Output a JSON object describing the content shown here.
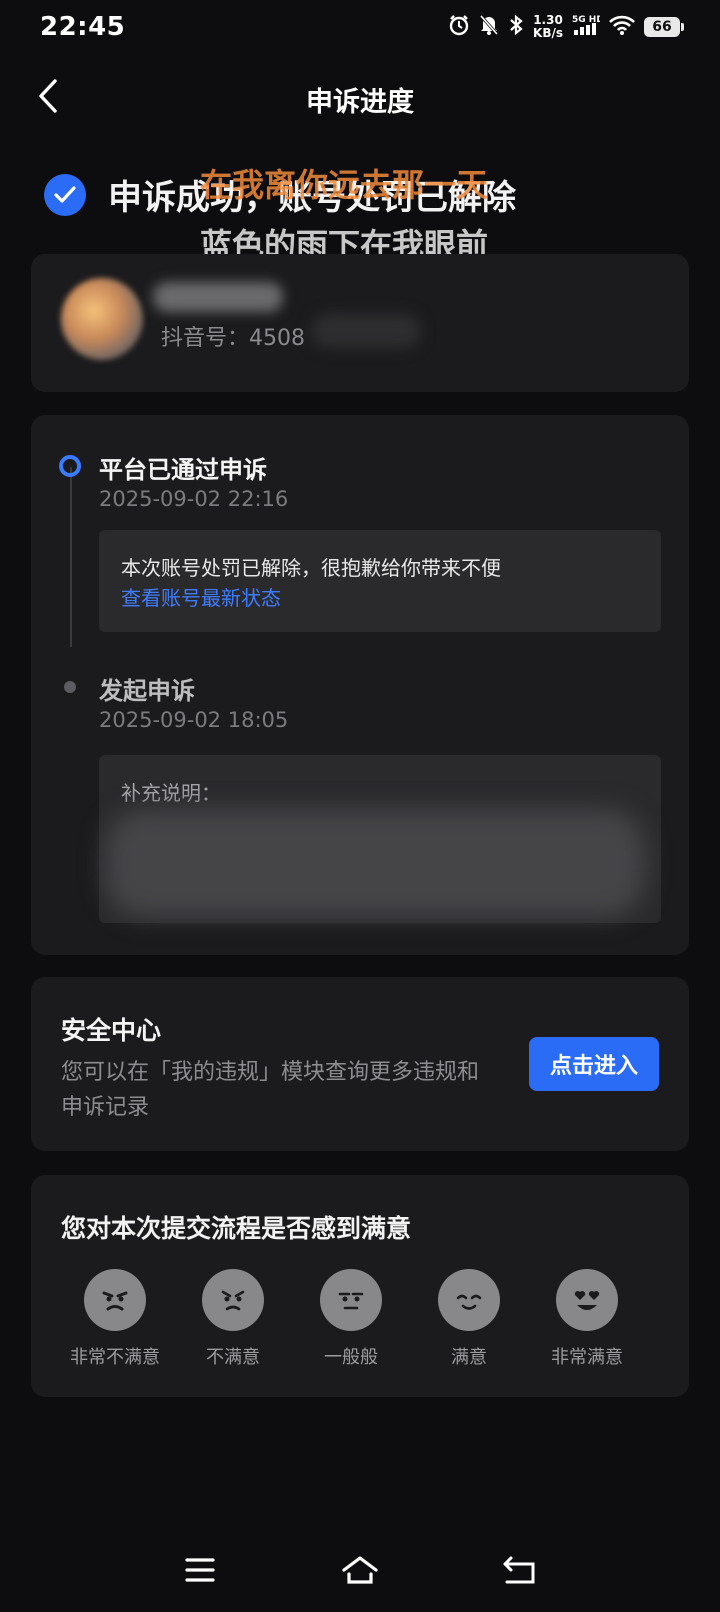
{
  "status_bar": {
    "time": "22:45",
    "net_speed_value": "1.30",
    "net_speed_unit": "KB/s",
    "network": "5G HD",
    "battery": "66"
  },
  "header": {
    "title": "申诉进度"
  },
  "result": {
    "text": "申诉成功，账号处罚已解除"
  },
  "lyric_overlay": {
    "line1": "在我离你远去那一天",
    "line2": "蓝色的雨下在我眼前"
  },
  "user": {
    "douyin_id_label": "抖音号：4508"
  },
  "timeline": {
    "step1": {
      "title": "平台已通过申诉",
      "time": "2025-09-02 22:16",
      "note": "本次账号处罚已解除，很抱歉给你带来不便",
      "link": "查看账号最新状态"
    },
    "step2": {
      "title": "发起申诉",
      "time": "2025-09-02 18:05",
      "note_label": "补充说明："
    }
  },
  "safety": {
    "title": "安全中心",
    "desc": "您可以在「我的违规」模块查询更多违规和申诉记录",
    "button": "点击进入"
  },
  "feedback": {
    "title": "您对本次提交流程是否感到满意",
    "options": [
      "非常不满意",
      "不满意",
      "一般般",
      "满意",
      "非常满意"
    ]
  },
  "colors": {
    "accent": "#2b6cf6",
    "link": "#3e7dff",
    "card": "#1b1b1d",
    "background": "#0d0d0f"
  }
}
